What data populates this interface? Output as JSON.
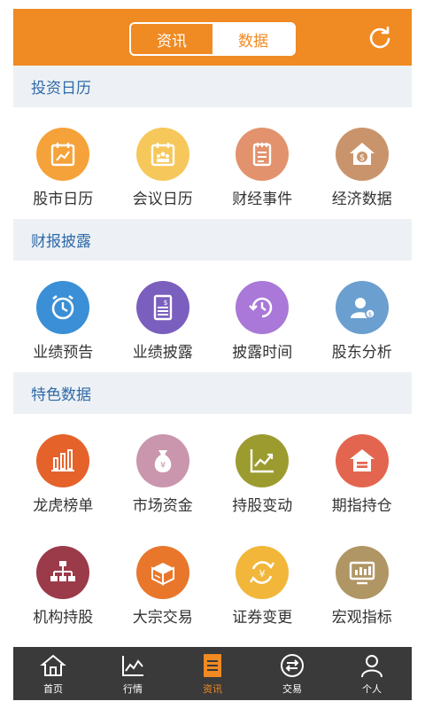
{
  "header": {
    "tabs": [
      "资讯",
      "数据"
    ],
    "active_tab": "数据"
  },
  "sections": [
    {
      "title": "投资日历",
      "items": [
        {
          "label": "股市日历",
          "icon": "calendar-chart-icon",
          "color": "#f5a23a"
        },
        {
          "label": "会议日历",
          "icon": "calendar-meeting-icon",
          "color": "#f6c85b"
        },
        {
          "label": "财经事件",
          "icon": "notepad-icon",
          "color": "#e2926d"
        },
        {
          "label": "经济数据",
          "icon": "house-money-icon",
          "color": "#c9946c"
        }
      ]
    },
    {
      "title": "财报披露",
      "items": [
        {
          "label": "业绩预告",
          "icon": "alarm-clock-icon",
          "color": "#3a8fd6"
        },
        {
          "label": "业绩披露",
          "icon": "report-document-icon",
          "color": "#7b5fbe"
        },
        {
          "label": "披露时间",
          "icon": "clock-icon",
          "color": "#a978d8"
        },
        {
          "label": "股东分析",
          "icon": "shareholder-icon",
          "color": "#6b9fcf"
        }
      ]
    },
    {
      "title": "特色数据",
      "items": [
        {
          "label": "龙虎榜单",
          "icon": "bar-chart-icon",
          "color": "#e5622b"
        },
        {
          "label": "市场资金",
          "icon": "money-bag-icon",
          "color": "#c996ad"
        },
        {
          "label": "持股变动",
          "icon": "trend-chart-icon",
          "color": "#9c9b2f"
        },
        {
          "label": "期指持仓",
          "icon": "warehouse-icon",
          "color": "#e3654f"
        },
        {
          "label": "机构持股",
          "icon": "org-chart-icon",
          "color": "#9b3a48"
        },
        {
          "label": "大宗交易",
          "icon": "box-icon",
          "color": "#e8772c"
        },
        {
          "label": "证券变更",
          "icon": "yuan-exchange-icon",
          "color": "#f1b63a"
        },
        {
          "label": "宏观指标",
          "icon": "monitor-icon",
          "color": "#b09664"
        }
      ]
    }
  ],
  "tabbar": {
    "active": "资讯",
    "items": [
      {
        "label": "首页",
        "icon": "home-icon"
      },
      {
        "label": "行情",
        "icon": "line-chart-icon"
      },
      {
        "label": "资讯",
        "icon": "news-icon"
      },
      {
        "label": "交易",
        "icon": "exchange-icon"
      },
      {
        "label": "个人",
        "icon": "person-icon"
      }
    ]
  }
}
